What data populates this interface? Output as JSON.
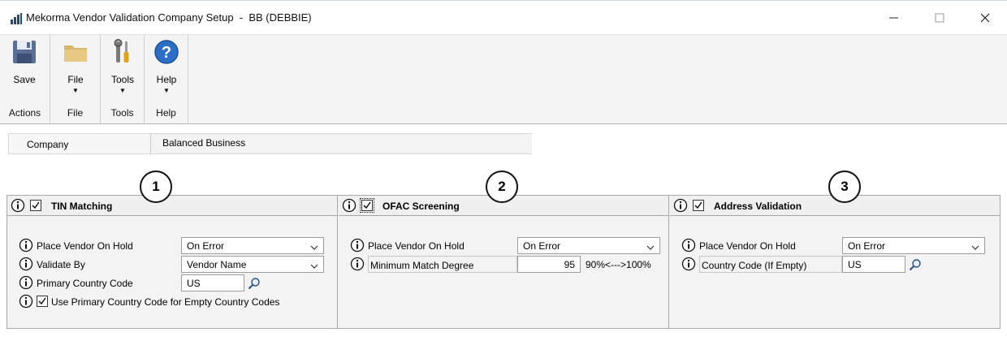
{
  "window": {
    "title": "Mekorma Vendor Validation Company Setup  -  BB (DEBBIE)",
    "minimize_glyph": "—",
    "maximize_glyph": "☐",
    "close_glyph": "✕"
  },
  "ribbon": {
    "groups": [
      {
        "label": "Actions",
        "buttons": [
          {
            "label": "Save",
            "icon": "save-icon"
          }
        ]
      },
      {
        "label": "File",
        "buttons": [
          {
            "label": "File",
            "icon": "folder-icon",
            "dropdown": true
          }
        ]
      },
      {
        "label": "Tools",
        "buttons": [
          {
            "label": "Tools",
            "icon": "tools-icon",
            "dropdown": true
          }
        ]
      },
      {
        "label": "Help",
        "buttons": [
          {
            "label": "Help",
            "icon": "help-icon",
            "dropdown": true
          }
        ]
      }
    ],
    "dropdown_arrow": "▼"
  },
  "company": {
    "label": "Company",
    "value": "Balanced Business"
  },
  "callouts": [
    "1",
    "2",
    "3"
  ],
  "sections": {
    "tin": {
      "title": "TIN Matching",
      "enabled": true,
      "place_on_hold_label": "Place Vendor On Hold",
      "place_on_hold_value": "On Error",
      "validate_by_label": "Validate By",
      "validate_by_value": "Vendor Name",
      "primary_country_label": "Primary Country Code",
      "primary_country_value": "US",
      "use_primary_label": "Use Primary Country Code for Empty Country Codes",
      "use_primary_checked": true
    },
    "ofac": {
      "title": "OFAC Screening",
      "enabled": true,
      "place_on_hold_label": "Place Vendor On Hold",
      "place_on_hold_value": "On Error",
      "min_match_label": "Minimum Match Degree",
      "min_match_value": "95",
      "min_match_range": "90%<--->100%"
    },
    "address": {
      "title": "Address Validation",
      "enabled": true,
      "place_on_hold_label": "Place Vendor On Hold",
      "place_on_hold_value": "On Error",
      "country_code_label": "Country Code (If Empty)",
      "country_code_value": "US"
    }
  }
}
